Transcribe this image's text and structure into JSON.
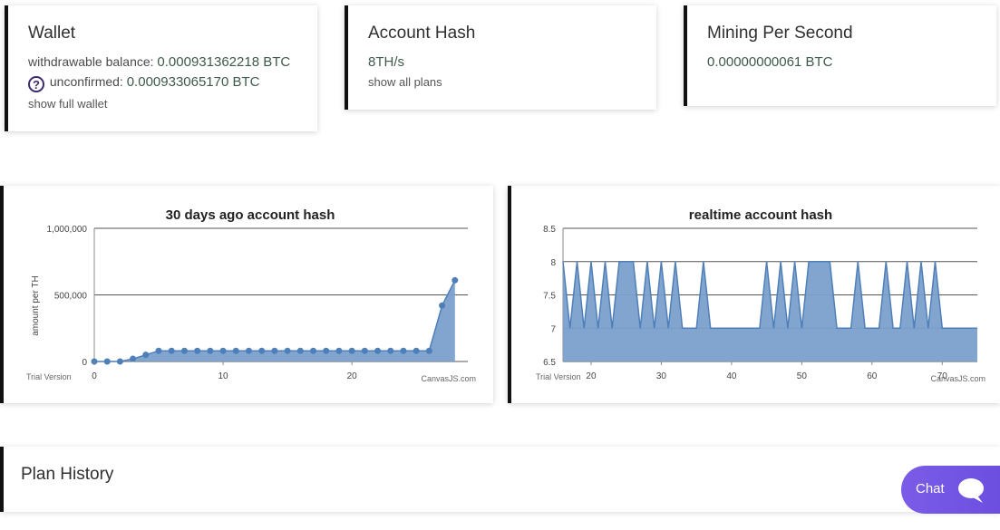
{
  "wallet": {
    "title": "Wallet",
    "withdrawable_label": "withdrawable balance:",
    "withdrawable_value": "0.000931362218 BTC",
    "unconfirmed_label": "unconfirmed:",
    "unconfirmed_value": "0.000933065170 BTC",
    "link": "show full wallet"
  },
  "account_hash": {
    "title": "Account Hash",
    "value": "8TH/s",
    "link": "show all plans"
  },
  "mining": {
    "title": "Mining Per Second",
    "value": "0.00000000061 BTC"
  },
  "plan_history": {
    "title": "Plan History"
  },
  "chat": {
    "label": "Chat"
  },
  "colors": {
    "accent_border": "#111111",
    "chart_fill": "#7aa0cc",
    "chart_line": "#4f7fb8",
    "chat_bg": "#7a5ce8"
  },
  "chart_data": [
    {
      "type": "area",
      "title": "30 days ago account hash",
      "ylabel": "amount per TH",
      "xlabel": "",
      "watermark_left": "Trial Version",
      "watermark_right": "CanvasJS.com",
      "xlim": [
        0,
        29
      ],
      "ylim": [
        0,
        1000000
      ],
      "x_ticks": [
        0,
        10,
        20
      ],
      "y_ticks": [
        0,
        500000,
        1000000
      ],
      "y_tick_labels": [
        "0",
        "500,000",
        "1,000,000"
      ],
      "markers": true,
      "series": [
        {
          "x": [
            0,
            1,
            2,
            3,
            4,
            5,
            6,
            7,
            8,
            9,
            10,
            11,
            12,
            13,
            14,
            15,
            16,
            17,
            18,
            19,
            20,
            21,
            22,
            23,
            24,
            25,
            26,
            27,
            28
          ],
          "values": [
            0,
            0,
            0,
            20000,
            50000,
            80000,
            80000,
            80000,
            80000,
            80000,
            80000,
            80000,
            80000,
            80000,
            80000,
            80000,
            80000,
            80000,
            80000,
            80000,
            80000,
            80000,
            80000,
            80000,
            80000,
            80000,
            80000,
            420000,
            610000
          ]
        }
      ]
    },
    {
      "type": "area",
      "title": "realtime account hash",
      "ylabel": "",
      "xlabel": "",
      "watermark_left": "Trial Version",
      "watermark_right": "CanvasJS.com",
      "xlim": [
        16,
        75
      ],
      "ylim": [
        6.5,
        8.5
      ],
      "x_ticks": [
        20,
        30,
        40,
        50,
        60,
        70
      ],
      "y_ticks": [
        6.5,
        7,
        7.5,
        8,
        8.5
      ],
      "y_tick_labels": [
        "6.5",
        "7",
        "7.5",
        "8",
        "8.5"
      ],
      "markers": false,
      "series": [
        {
          "x": [
            16,
            17,
            18,
            19,
            20,
            21,
            22,
            23,
            24,
            25,
            26,
            27,
            28,
            29,
            30,
            31,
            32,
            33,
            34,
            35,
            36,
            37,
            38,
            39,
            40,
            41,
            42,
            43,
            44,
            45,
            46,
            47,
            48,
            49,
            50,
            51,
            52,
            53,
            54,
            55,
            56,
            57,
            58,
            59,
            60,
            61,
            62,
            63,
            64,
            65,
            66,
            67,
            68,
            69,
            70,
            71,
            72,
            73,
            74,
            75
          ],
          "values": [
            8,
            7,
            8,
            7,
            8,
            7,
            8,
            7,
            8,
            8,
            8,
            7,
            8,
            7,
            8,
            7,
            8,
            7,
            7,
            7,
            8,
            7,
            7,
            7,
            7,
            7,
            7,
            7,
            7,
            8,
            7,
            8,
            7,
            8,
            7,
            8,
            8,
            8,
            8,
            7,
            7,
            7,
            8,
            7,
            7,
            7,
            8,
            7,
            7,
            8,
            7,
            8,
            7,
            8,
            7,
            7,
            7,
            7,
            7,
            7
          ]
        }
      ]
    }
  ]
}
